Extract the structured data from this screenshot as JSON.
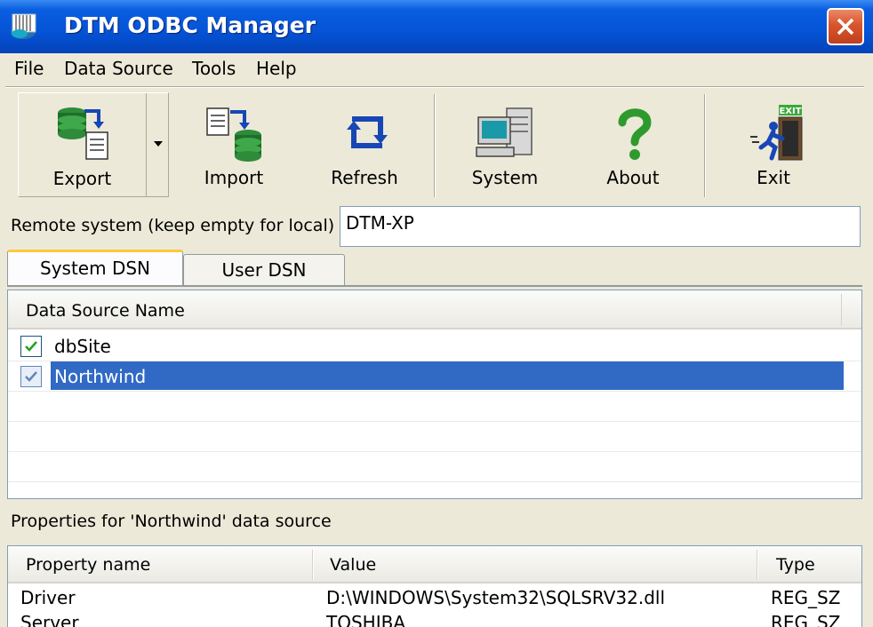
{
  "window": {
    "title": "DTM ODBC Manager",
    "icon": "database-grid-icon",
    "close_icon": "close-icon"
  },
  "menu": {
    "items": [
      "File",
      "Data Source",
      "Tools",
      "Help"
    ]
  },
  "toolbar": {
    "export_label": "Export",
    "import_label": "Import",
    "refresh_label": "Refresh",
    "system_label": "System",
    "about_label": "About",
    "exit_label": "Exit",
    "exit_sign_text": "EXIT"
  },
  "remote": {
    "label": "Remote system (keep empty for local)",
    "value": "DTM-XP"
  },
  "tabs": [
    {
      "label": "System DSN",
      "active": true
    },
    {
      "label": "User DSN",
      "active": false
    }
  ],
  "dsn_list": {
    "header": "Data Source Name",
    "rows": [
      {
        "name": "dbSite",
        "checked": true,
        "selected": false
      },
      {
        "name": "Northwind",
        "checked": true,
        "selected": true
      }
    ]
  },
  "properties": {
    "label": "Properties for 'Northwind' data source",
    "columns": [
      "Property name",
      "Value",
      "Type"
    ],
    "rows": [
      {
        "name": "Driver",
        "value": "D:\\WINDOWS\\System32\\SQLSRV32.dll",
        "type": "REG_SZ"
      },
      {
        "name": "Server",
        "value": "TOSHIBA",
        "type": "REG_SZ"
      }
    ]
  },
  "colors": {
    "titlebar": "#0553d6",
    "selection": "#316ac5",
    "tab_highlight": "#ffc83c",
    "close": "#d9542a"
  }
}
